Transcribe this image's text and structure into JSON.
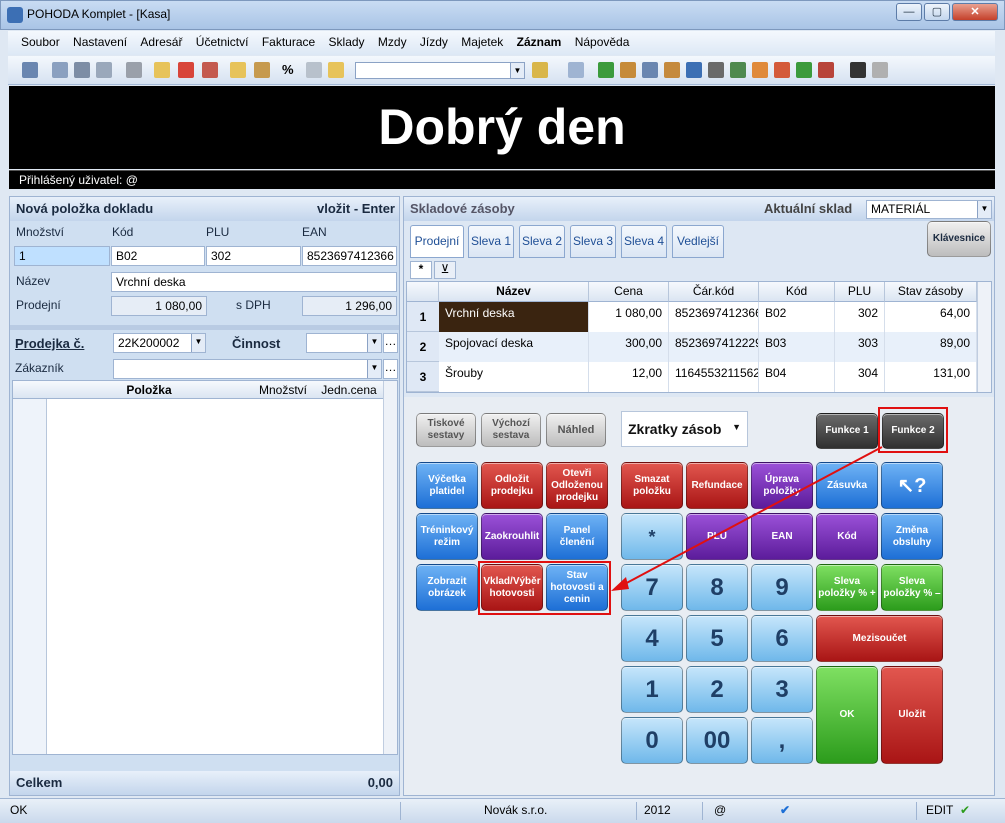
{
  "window": {
    "title": "POHODA Komplet - [Kasa]",
    "min": "—",
    "max": "▢",
    "close": "✕"
  },
  "menu": [
    "Soubor",
    "Nastavení",
    "Adresář",
    "Účetnictví",
    "Fakturace",
    "Sklady",
    "Mzdy",
    "Jízdy",
    "Majetek",
    "Záznam",
    "Nápověda"
  ],
  "greeting": "Dobrý den",
  "user_label": "Přihlášený uživatel: @",
  "new_item": {
    "title": "Nová položka dokladu",
    "insert_hint": "vložit - Enter",
    "labels": {
      "qty": "Množství",
      "code": "Kód",
      "plu": "PLU",
      "ean": "EAN",
      "name": "Název",
      "price": "Prodejní",
      "vat": "s DPH"
    },
    "values": {
      "qty": "1",
      "code": "B02",
      "plu": "302",
      "ean": "8523697412366",
      "name": "Vrchní deska",
      "price": "1 080,00",
      "price_vat": "1 296,00"
    }
  },
  "receipt": {
    "label": "Prodejka č.",
    "number": "22K200002",
    "activity_label": "Činnost",
    "customer_label": "Zákazník",
    "columns": [
      "Položka",
      "Množství",
      "Jedn.cena"
    ],
    "total_label": "Celkem",
    "total": "0,00"
  },
  "stock": {
    "title": "Skladové zásoby",
    "warehouse_label": "Aktuální sklad",
    "warehouse": "MATERIÁL",
    "tabs": [
      "Prodejní",
      "Sleva 1",
      "Sleva 2",
      "Sleva 3",
      "Sleva 4",
      "Vedlejší"
    ],
    "keyboard_button": "Klávesnice",
    "toolbar": [
      "*",
      "⊻"
    ],
    "columns": [
      "Název",
      "Cena",
      "Čár.kód",
      "Kód",
      "PLU",
      "Stav zásoby"
    ],
    "rows": [
      {
        "n": "1",
        "name": "Vrchní deska",
        "price": "1 080,00",
        "ean": "8523697412366",
        "code": "B02",
        "plu": "302",
        "qty": "64,00"
      },
      {
        "n": "2",
        "name": "Spojovací deska",
        "price": "300,00",
        "ean": "8523697412229",
        "code": "B03",
        "plu": "303",
        "qty": "89,00"
      },
      {
        "n": "3",
        "name": "Šrouby",
        "price": "12,00",
        "ean": "1164553211562",
        "code": "B04",
        "plu": "304",
        "qty": "131,00"
      }
    ]
  },
  "keypad": {
    "print": "Tiskové sestavy",
    "default": "Výchozí sestava",
    "preview": "Náhled",
    "shortcuts": "Zkratky zásob",
    "f1": "Funkce 1",
    "f2": "Funkce 2",
    "tally": "Výčetka platidel",
    "park": "Odložit prodejku",
    "open_parked": "Otevři Odloženou prodejku",
    "delete": "Smazat položku",
    "refund": "Refundace",
    "edit": "Úprava položky",
    "drawer": "Zásuvka",
    "help": "↖?",
    "training": "Tréninkový režim",
    "round": "Zaokrouhlit",
    "split": "Panel členění",
    "star": "*",
    "plu": "PLU",
    "ean": "EAN",
    "code": "Kód",
    "change_op": "Změna obsluhy",
    "image": "Zobrazit obrázek",
    "cash": "Vklad/Výběr hotovosti",
    "cash_state": "Stav hotovosti a cenin",
    "d7": "7",
    "d8": "8",
    "d9": "9",
    "disc_plus": "Sleva položky % +",
    "disc_minus": "Sleva položky % –",
    "d4": "4",
    "d5": "5",
    "d6": "6",
    "subtotal": "Mezisoučet",
    "d1": "1",
    "d2": "2",
    "d3": "3",
    "d0": "0",
    "d00": "00",
    "comma": ",",
    "ok": "OK",
    "store": "Uložit"
  },
  "status": {
    "state": "OK",
    "company": "Novák s.r.o.",
    "year": "2012",
    "at": "@",
    "mode": "EDIT"
  },
  "colors": {
    "greeting_bg": "#000000",
    "highlight": "#e01010"
  }
}
